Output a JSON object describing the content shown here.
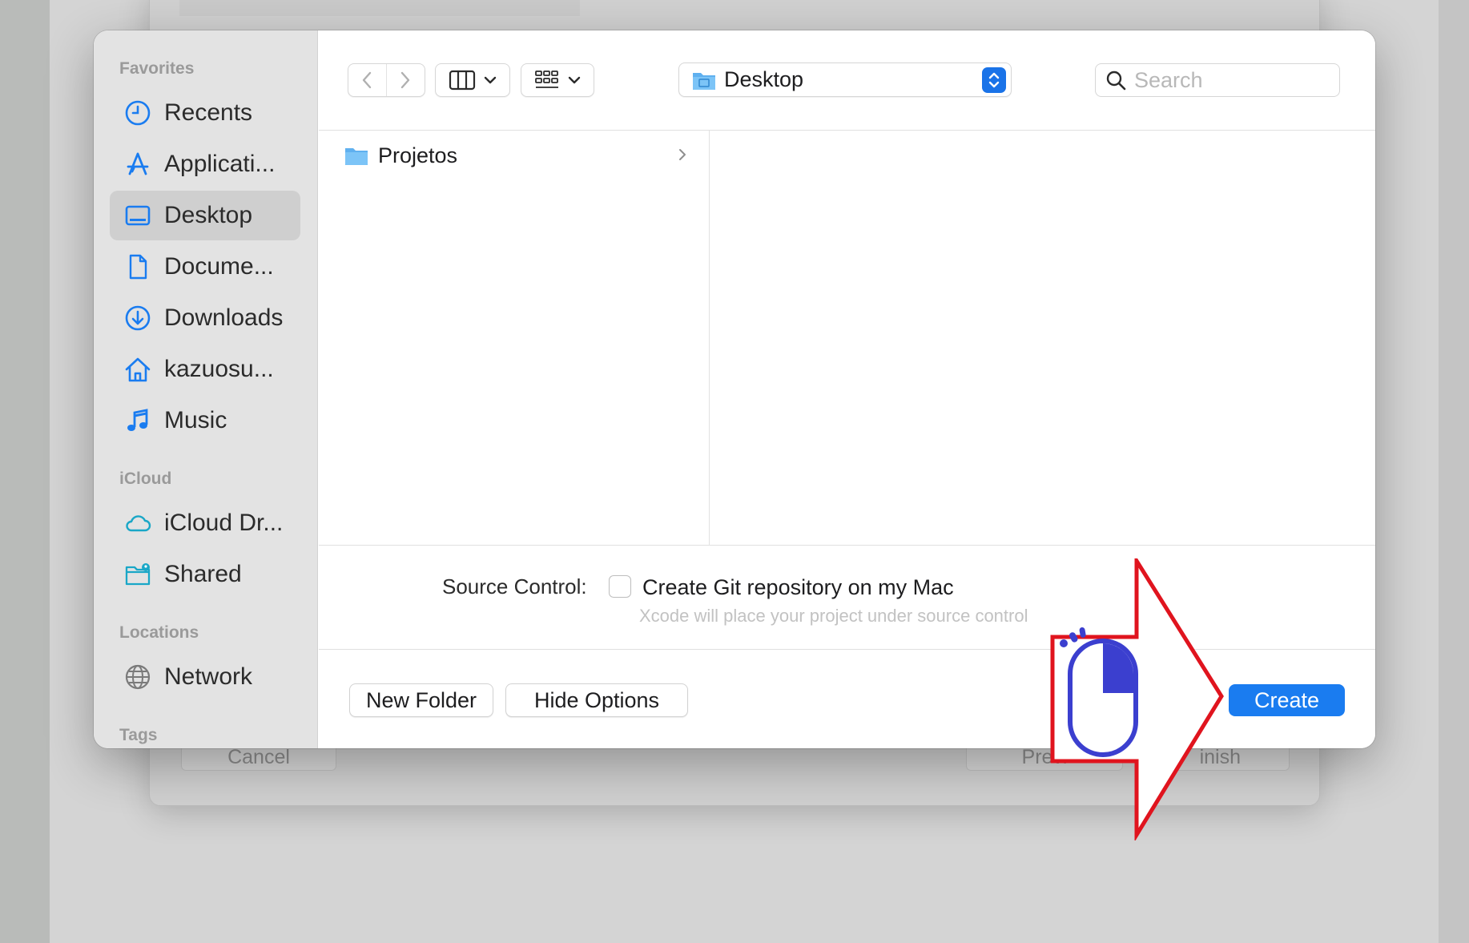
{
  "background_window": {
    "cancel_label": "Cancel",
    "previous_label": "Previ",
    "finish_label": "inish"
  },
  "sidebar": {
    "sections": [
      {
        "heading": "Favorites",
        "items": [
          {
            "label": "Recents",
            "icon": "clock-icon"
          },
          {
            "label": "Applicati...",
            "icon": "applications-icon"
          },
          {
            "label": "Desktop",
            "icon": "desktop-icon",
            "selected": true
          },
          {
            "label": "Docume...",
            "icon": "document-icon"
          },
          {
            "label": "Downloads",
            "icon": "download-icon"
          },
          {
            "label": "kazuosu...",
            "icon": "home-icon"
          },
          {
            "label": "Music",
            "icon": "music-note-icon"
          }
        ]
      },
      {
        "heading": "iCloud",
        "items": [
          {
            "label": "iCloud Dr...",
            "icon": "cloud-icon"
          },
          {
            "label": "Shared",
            "icon": "shared-folder-icon"
          }
        ]
      },
      {
        "heading": "Locations",
        "items": [
          {
            "label": "Network",
            "icon": "globe-icon"
          }
        ]
      },
      {
        "heading": "Tags",
        "items": []
      }
    ]
  },
  "toolbar": {
    "location": "Desktop",
    "search_placeholder": "Search"
  },
  "browser": {
    "items": [
      {
        "label": "Projetos",
        "icon": "folder-icon"
      }
    ]
  },
  "options": {
    "source_control_label": "Source Control:",
    "git_checkbox_label": "Create Git repository on my Mac",
    "git_checkbox_checked": false,
    "hint": "Xcode will place your project under source control"
  },
  "footer": {
    "new_folder_label": "New Folder",
    "hide_options_label": "Hide Options",
    "create_label": "Create"
  },
  "colors": {
    "accent": "#1a7cf0",
    "annotation_arrow": "#e0141e",
    "annotation_mouse": "#3b3fcf"
  }
}
